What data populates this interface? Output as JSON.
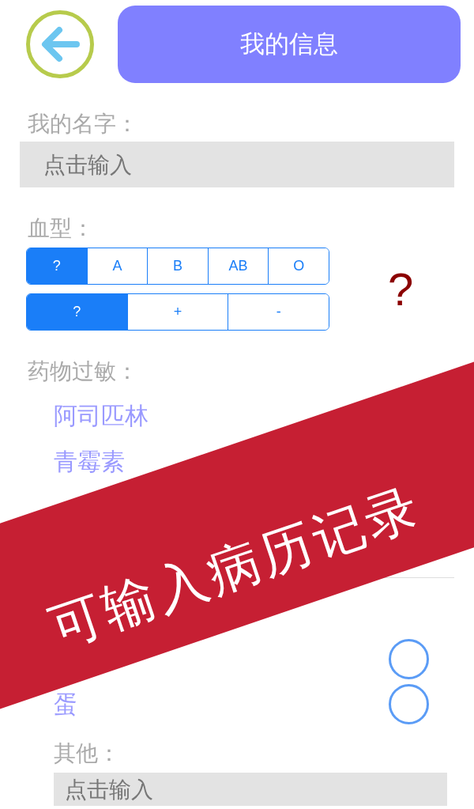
{
  "header": {
    "title": "我的信息"
  },
  "name_section": {
    "label": "我的名字：",
    "field": {
      "placeholder": "点击输入"
    }
  },
  "blood_type": {
    "label": "血型：",
    "groups": [
      {
        "options": [
          {
            "label": "?",
            "selected": true
          },
          {
            "label": "A",
            "selected": false
          },
          {
            "label": "B",
            "selected": false
          },
          {
            "label": "AB",
            "selected": false
          },
          {
            "label": "O",
            "selected": false
          }
        ]
      },
      {
        "options": [
          {
            "label": "?",
            "selected": true
          },
          {
            "label": "+",
            "selected": false
          },
          {
            "label": "-",
            "selected": false
          }
        ]
      }
    ],
    "result": "?"
  },
  "drug_allergy": {
    "label": "药物过敏：",
    "items": [
      {
        "label": "阿司匹林"
      },
      {
        "label": "青霉素"
      }
    ]
  },
  "food_allergy": {
    "items": [
      {
        "checked": false
      },
      {
        "label": "蛋",
        "checked": false
      }
    ],
    "other": {
      "label": "其他：",
      "field": {
        "placeholder": "点击输入"
      }
    }
  },
  "banner": {
    "text": "可输入病历记录"
  }
}
